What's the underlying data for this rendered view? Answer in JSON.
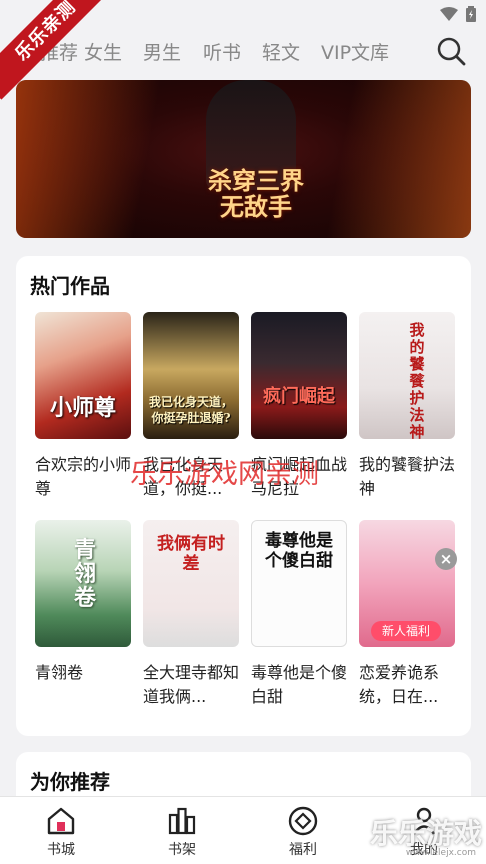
{
  "corner_ribbon": "乐乐亲测",
  "tabs": [
    "推荐",
    "女生",
    "男生",
    "听书",
    "轻文",
    "VIP文库"
  ],
  "banner": {
    "title_line1": "杀穿三界",
    "title_line2": "无敌手"
  },
  "hot_section": {
    "title": "热门作品",
    "books": [
      {
        "title": "合欢宗的小师尊",
        "cover_text": "小师尊"
      },
      {
        "title": "我已化身天道，你挺...",
        "cover_text": "我已化身天道，你挺孕肚退婚?"
      },
      {
        "title": "疯门崛起血战马尼拉",
        "cover_text": "疯门崛起"
      },
      {
        "title": "我的饕餮护法神",
        "cover_text": "我的饕餮护法神"
      },
      {
        "title": "青翎卷",
        "cover_text": "青翎卷"
      },
      {
        "title": "全大理寺都知道我俩...",
        "cover_text": "我俩有时差"
      },
      {
        "title": "毒尊他是个傻白甜",
        "cover_text": "毒尊他是个傻白甜"
      },
      {
        "title": "恋爱养诡系统，日在...",
        "cover_text": "",
        "promo_badge": "新人福利"
      }
    ]
  },
  "recommend_section": {
    "title": "为你推荐"
  },
  "bottom_nav": [
    {
      "label": "书城",
      "icon": "home-icon"
    },
    {
      "label": "书架",
      "icon": "bookshelf-icon"
    },
    {
      "label": "福利",
      "icon": "welfare-icon"
    },
    {
      "label": "我的",
      "icon": "profile-icon"
    }
  ],
  "watermark": {
    "center": "乐乐游戏网亲测",
    "corner": "乐乐游戏",
    "url": "www.lelejx.com"
  },
  "colors": {
    "accent": "#e0305a",
    "ribbon": "#c0161e",
    "watermark": "#e12828"
  }
}
